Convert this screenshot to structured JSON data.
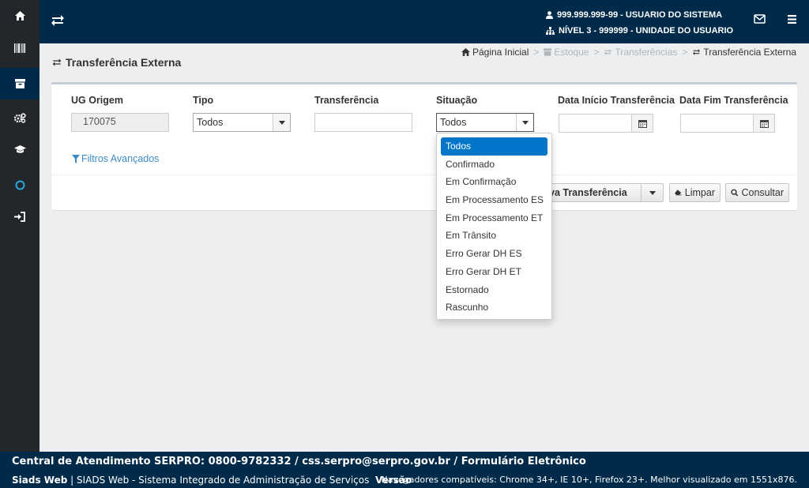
{
  "topbar": {
    "user_line1": "999.999.999-99 - USUARIO DO SISTEMA",
    "user_line2": "NÍVEL 3 - 999999 - UNIDADE DO USUARIO"
  },
  "page": {
    "title": "Transferência Externa"
  },
  "breadcrumb": [
    {
      "label": "Página Inicial",
      "state": "active"
    },
    {
      "label": "Estoque",
      "state": "muted"
    },
    {
      "label": "Transferências",
      "state": "muted"
    },
    {
      "label": "Transferência Externa",
      "state": "current"
    }
  ],
  "breadcrumb_sep": ">",
  "filters": {
    "ug_origem": {
      "label": "UG Origem",
      "value": "170075"
    },
    "tipo": {
      "label": "Tipo",
      "value": "Todos"
    },
    "transferencia": {
      "label": "Transferência",
      "value": ""
    },
    "situacao": {
      "label": "Situação",
      "value": "Todos"
    },
    "data_inicio": {
      "label": "Data Início Transferência",
      "value": ""
    },
    "data_fim": {
      "label": "Data Fim Transferência",
      "value": ""
    },
    "advanced": "Filtros Avançados"
  },
  "buttons": {
    "nova": "va Transferência",
    "limpar": "Limpar",
    "consultar": "Consultar"
  },
  "situacao_options": [
    "Todos",
    "Confirmado",
    "Em Confirmação",
    "Em Processamento ES",
    "Em Processamento ET",
    "Em Trânsito",
    "Erro Gerar DH ES",
    "Erro Gerar DH ET",
    "Estornado",
    "Rascunho"
  ],
  "situacao_selected_index": 0,
  "footer": {
    "central": "Central de Atendimento SERPRO: 0800-9782332 / css.serpro@serpro.gov.br / Formulário Eletrônico",
    "brand": "Siads Web",
    "sep": "|",
    "system": "SIADS Web - Sistema Integrado de Administração de Serviços",
    "version": "Versão",
    "compat": "Navegadores compatíveis: Chrome 34+, IE 10+, Firefox 23+. Melhor visualizado em 1551x876."
  },
  "colors": {
    "navy": "#002a4a",
    "sidebar": "#23272b",
    "accent_blue": "#0275c8",
    "link_blue": "#3a8bc9"
  },
  "icons": {
    "sidebar": [
      "home-icon",
      "barcode-icon",
      "archive-icon",
      "cogs-icon",
      "graduation-cap-icon",
      "circle-icon",
      "sign-in-icon"
    ],
    "topbar": [
      "exchange-icon",
      "user-icon",
      "sitemap-icon",
      "envelope-icon",
      "bars-icon"
    ]
  }
}
